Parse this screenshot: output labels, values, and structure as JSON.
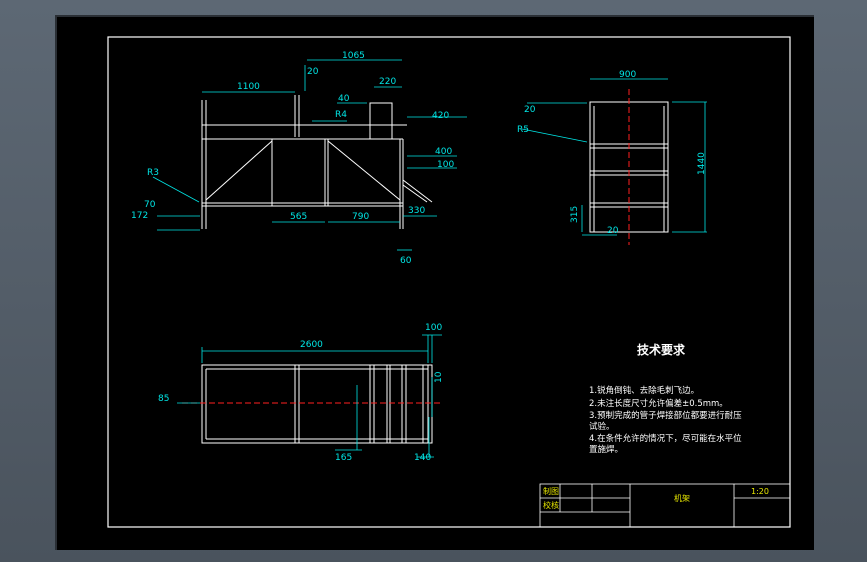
{
  "colors": {
    "background": "#000000",
    "frame": "#ffffff",
    "dimension": "#00e6e6",
    "centerline": "#ff2020",
    "titleblock_text": "#e6e600"
  },
  "front_view": {
    "dims": [
      "1065",
      "1100",
      "20",
      "220",
      "40",
      "R4",
      "420",
      "400",
      "100",
      "R3",
      "70",
      "172",
      "565",
      "790",
      "330",
      "60"
    ]
  },
  "side_view": {
    "dims": [
      "900",
      "20",
      "R5",
      "1440",
      "315",
      "20"
    ]
  },
  "top_view": {
    "dims": [
      "100",
      "2600",
      "85",
      "10",
      "165",
      "140"
    ]
  },
  "tech": {
    "title": "技术要求",
    "items": [
      "1.锐角倒钝、去除毛刺飞边。",
      "2.未注长度尺寸允许偏差±0.5mm。",
      "3.预制完成的管子焊接部位都要进行耐压",
      "试验。",
      "4.在条件允许的情况下，尽可能在水平位",
      "置施焊。"
    ]
  },
  "titleblock": {
    "drawn": "制图",
    "checked": "校核",
    "name": "机架",
    "scale": "1:20"
  }
}
